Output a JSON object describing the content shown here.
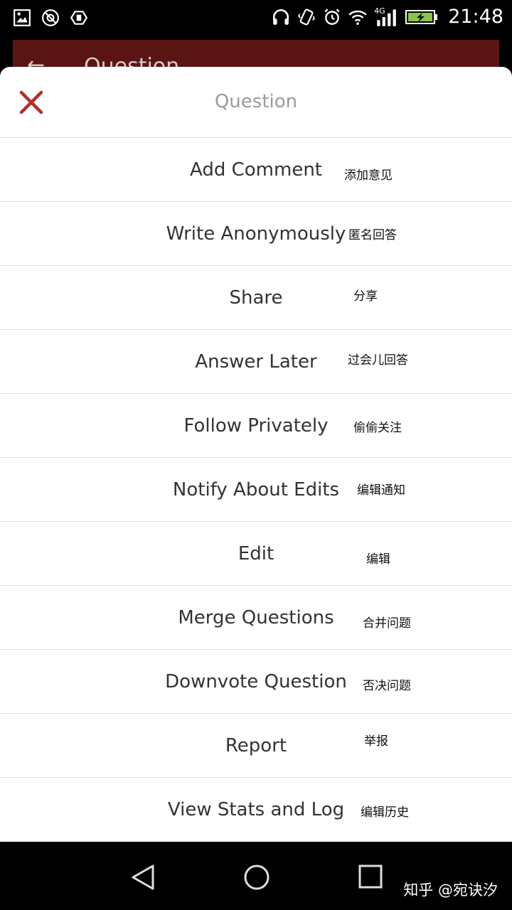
{
  "status_bar": {
    "time": "21:48",
    "network": "4G",
    "left_icons": [
      "image-icon",
      "no-disturb-icon",
      "hand-icon"
    ],
    "right_icons": [
      "headphones-icon",
      "vibrate-icon",
      "alarm-icon",
      "wifi-icon",
      "signal-icon",
      "battery-charging-icon"
    ]
  },
  "behind": {
    "title": "Question"
  },
  "sheet": {
    "title": "Question",
    "close_icon": "close-icon",
    "accent": "#b0302c",
    "items": [
      {
        "label": "Add Comment",
        "note": "添加意见"
      },
      {
        "label": "Write Anonymously",
        "note": "匿名回答"
      },
      {
        "label": "Share",
        "note": "分享"
      },
      {
        "label": "Answer Later",
        "note": "过会儿回答"
      },
      {
        "label": "Follow Privately",
        "note": "偷偷关注"
      },
      {
        "label": "Notify About Edits",
        "note": "编辑通知"
      },
      {
        "label": "Edit",
        "note": "编辑"
      },
      {
        "label": "Merge Questions",
        "note": "合并问题"
      },
      {
        "label": "Downvote Question",
        "note": "否决问题"
      },
      {
        "label": "Report",
        "note": "举报"
      },
      {
        "label": "View Stats and Log",
        "note": "编辑历史"
      }
    ]
  },
  "nav": {
    "icons": [
      "back-triangle-icon",
      "home-circle-icon",
      "recents-square-icon"
    ],
    "watermark": "知乎 @宛诀汐"
  }
}
